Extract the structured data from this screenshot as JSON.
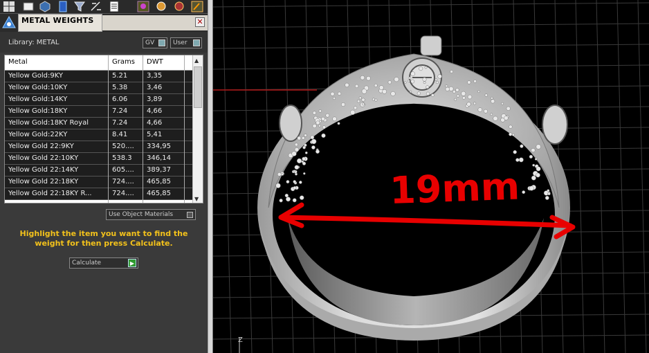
{
  "panel": {
    "title": "METAL WEIGHTS",
    "close_label": "✕",
    "library_label": "Library: METAL",
    "toggle_gv": "GV",
    "toggle_user": "User",
    "use_object_materials": "Use Object Materials",
    "hint": "Highlight the item you want to find the weight for then press Calculate.",
    "calculate_label": "Calculate"
  },
  "table": {
    "headers": [
      "Metal",
      "Grams",
      "DWT"
    ],
    "rows": [
      [
        "Yellow Gold:9KY",
        "5.21",
        "3,35"
      ],
      [
        "Yellow Gold:10KY",
        "5.38",
        "3,46"
      ],
      [
        "Yellow Gold:14KY",
        "6.06",
        "3,89"
      ],
      [
        "Yellow Gold:18KY",
        "7.24",
        "4,66"
      ],
      [
        "Yellow Gold:18KY Royal",
        "7.24",
        "4,66"
      ],
      [
        "Yellow Gold:22KY",
        "8.41",
        "5,41"
      ],
      [
        "Yellow Gold 22:9KY",
        "520....",
        "334,95"
      ],
      [
        "Yellow Gold 22:10KY",
        "538.3",
        "346,14"
      ],
      [
        "Yellow Gold 22:14KY",
        "605....",
        "389,37"
      ],
      [
        "Yellow Gold 22:18KY",
        "724....",
        "465,85"
      ],
      [
        "Yellow Gold 22:18KY R...",
        "724....",
        "465,85"
      ]
    ]
  },
  "viewport": {
    "annotation_text": "19mm",
    "axis_label": "Z",
    "colors": {
      "grid": "#3a3a3a",
      "axis_red": "#b01818",
      "axis_teal": "#1e9fb0",
      "annotation": "#e80000",
      "ring": "#c8c8c8"
    }
  }
}
